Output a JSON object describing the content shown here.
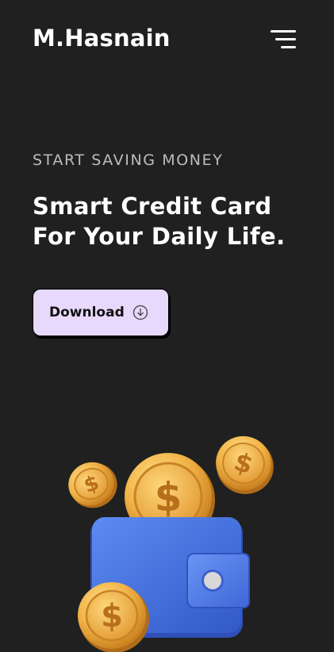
{
  "header": {
    "brand": "M.Hasnain",
    "menu_icon": "hamburger-menu-icon"
  },
  "hero": {
    "eyebrow": "START SAVING MONEY",
    "headline_line1": "Smart Credit Card",
    "headline_line2": "For Your Daily Life.",
    "download_label": "Download",
    "download_icon": "download-circle-icon"
  },
  "illustration": {
    "name": "wallet-with-dollar-coins",
    "coin_symbol": "$",
    "wallet_color": "#4a78e6",
    "coin_color": "#f0b24a"
  },
  "colors": {
    "background": "#202020",
    "button_bg": "#e6d9fb",
    "text_primary": "#ffffff",
    "text_muted": "#bcbcbc"
  }
}
